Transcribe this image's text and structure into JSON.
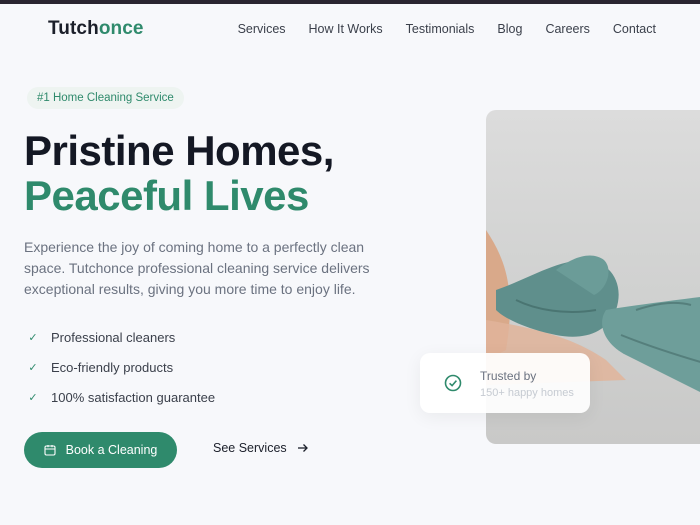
{
  "brand": {
    "part1": "Tutch",
    "part2": "once"
  },
  "nav": {
    "links": [
      "Services",
      "How It Works",
      "Testimonials",
      "Blog",
      "Careers",
      "Contact"
    ]
  },
  "hero": {
    "badge": "#1 Home Cleaning Service",
    "title_line1": "Pristine Homes,",
    "title_line2": "Peaceful Lives",
    "description": "Experience the joy of coming home to a perfectly clean space. Tutchonce professional cleaning service delivers exceptional results, giving you more time to enjoy life.",
    "features": [
      "Professional cleaners",
      "Eco-friendly products",
      "100% satisfaction guarantee"
    ],
    "primary_button": "Book a Cleaning",
    "secondary_link": "See Services",
    "icons": {
      "primary_button": "calendar-icon",
      "secondary_link": "arrow-right-icon",
      "feature": "check-icon",
      "trust": "check-circle-icon"
    }
  },
  "trust": {
    "title": "Trusted by",
    "subtitle": "150+ happy homes"
  },
  "colors": {
    "accent": "#2f8a6c",
    "background": "#f7f8fb",
    "text": "#1b1f2a"
  }
}
